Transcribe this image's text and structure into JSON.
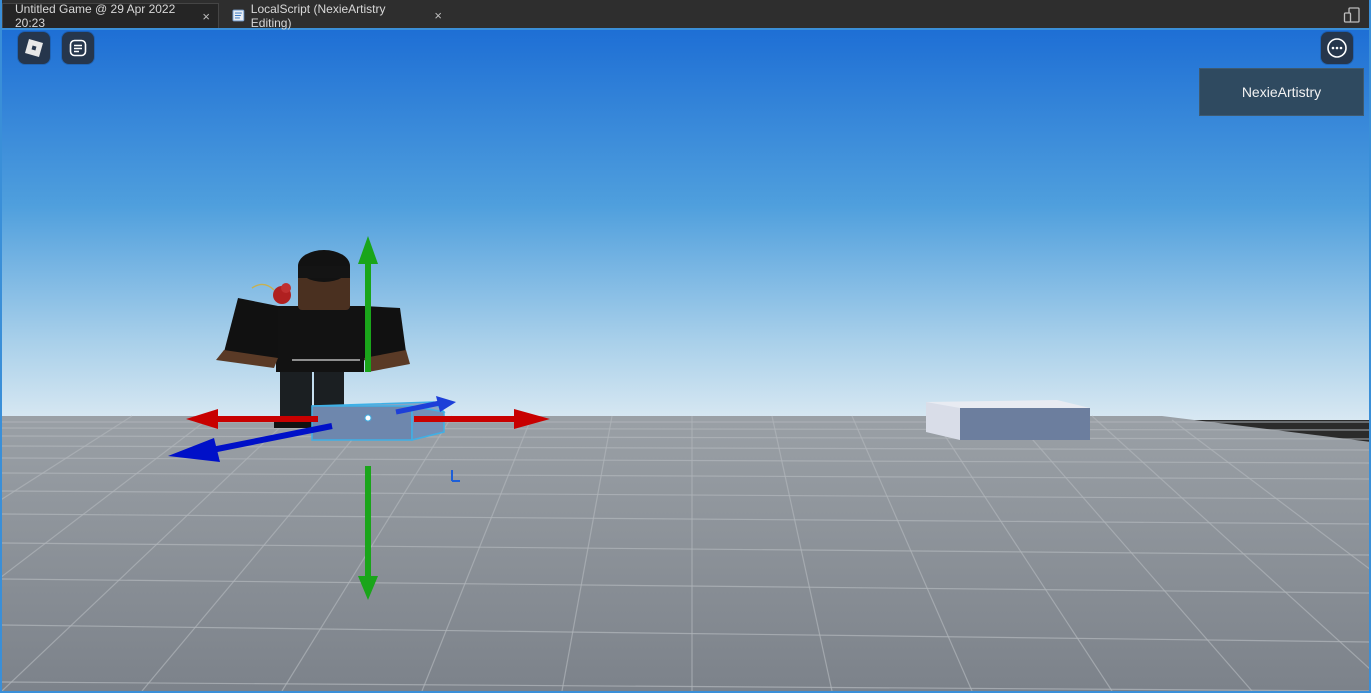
{
  "tabs": [
    {
      "title": "Untitled Game @ 29 Apr 2022 20:23",
      "close": "×"
    },
    {
      "title": "LocalScript (NexieArtistry Editing)",
      "close": "×"
    }
  ],
  "viewport": {
    "player_list": {
      "username": "NexieArtistry"
    },
    "buttons": {
      "roblox_menu_icon": "roblox-logo-icon",
      "chat_icon": "chat-icon",
      "more_icon": "more-icon"
    },
    "colors": {
      "sky_top": "#1e6fd5",
      "sky_bottom": "#d8e8f2",
      "baseplate": "#8a9097",
      "gizmo_x": "#c80000",
      "gizmo_y": "#1aa51a",
      "gizmo_z": "#0010c8",
      "selection": "#3fb0e6"
    }
  }
}
